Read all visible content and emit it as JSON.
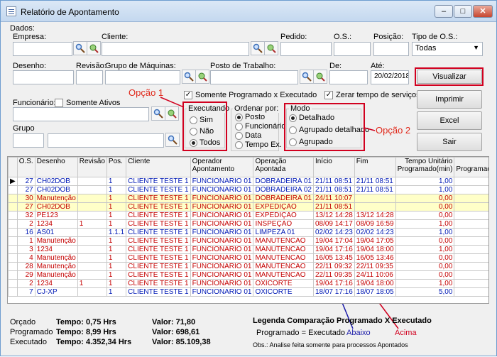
{
  "window": {
    "title": "Relatório de Apontamento"
  },
  "dados": {
    "group_title": "Dados:",
    "empresa_label": "Empresa:",
    "cliente_label": "Cliente:",
    "pedido_label": "Pedido:",
    "os_label": "O.S.:",
    "posicao_label": "Posição:",
    "tipo_os_label": "Tipo de O.S.:",
    "tipo_os_value": "Todas",
    "desenho_label": "Desenho:",
    "revisao_label": "Revisão:",
    "grupo_maquinas_label": "Grupo de Máquinas:",
    "posto_label": "Posto de Trabalho:",
    "de_label": "De:",
    "ate_label": "Até:",
    "ate_value": "20/02/2018",
    "funcionario_label": "Funcionário:",
    "somente_ativos_label": "Somente Ativos",
    "grupo_label": "Grupo",
    "somente_programado_label": "Somente Programado x Executado",
    "zerar_label": "Zerar tempo de serviços"
  },
  "executando": {
    "title": "Executando",
    "options": [
      "Sim",
      "Não",
      "Todos"
    ]
  },
  "ordenar": {
    "title": "Ordenar por:",
    "options": [
      "Posto",
      "Funcionário",
      "Data",
      "Tempo Ex."
    ]
  },
  "modo": {
    "title": "Modo",
    "options": [
      "Detalhado",
      "Agrupado detalhado",
      "Agrupado"
    ]
  },
  "annotations": {
    "opcao1": "Opção 1",
    "opcao2": "Opção 2",
    "abaixo": "Abaixo",
    "acima": "Acima"
  },
  "buttons": {
    "visualizar": "Visualizar",
    "imprimir": "Imprimir",
    "excel": "Excel",
    "sair": "Sair"
  },
  "table": {
    "headers": [
      "O.S.",
      "Desenho",
      "Revisão",
      "Pos.",
      "Cliente",
      "Operador Apontamento",
      "Operação Apontada",
      "Início",
      "Fim",
      "Tempo Unitário Programado(min)",
      "Tempo Programado(min)"
    ],
    "rows": [
      {
        "style": "blue",
        "cells": [
          "27",
          "CH02DOB",
          "",
          "1",
          "CLIENTE TESTE 1",
          "FUNCIONARIO 01",
          "DOBRADEIRA 01",
          "21/11 08:51",
          "21/11 08:51",
          "1,00",
          "40,00"
        ]
      },
      {
        "style": "blue",
        "cells": [
          "27",
          "CH02DOB",
          "",
          "1",
          "CLIENTE TESTE 1",
          "FUNCIONARIO 01",
          "DOBRADEIRA 02",
          "21/11 08:51",
          "21/11 08:51",
          "1,00",
          "40,00"
        ]
      },
      {
        "style": "red hi",
        "cells": [
          "30",
          "Manutenção",
          "",
          "1",
          "CLIENTE TESTE 1",
          "FUNCIONARIO 01",
          "DOBRADEIRA 01",
          "24/11 10:07",
          "",
          "0,00",
          "0,00"
        ]
      },
      {
        "style": "red hi",
        "cells": [
          "27",
          "CH02DOB",
          "",
          "1",
          "CLIENTE TESTE 1",
          "FUNCIONARIO 01",
          "EXPEDIÇÃO",
          "21/11 08:51",
          "",
          "0,00",
          "0,00"
        ]
      },
      {
        "style": "red",
        "cells": [
          "32",
          "PE123",
          "",
          "1",
          "CLIENTE TESTE 1",
          "FUNCIONARIO 01",
          "EXPEDIÇÃO",
          "13/12 14:28",
          "13/12 14:28",
          "0,00",
          "0,00"
        ]
      },
      {
        "style": "red",
        "cells": [
          "2",
          "1234",
          "1",
          "1",
          "CLIENTE TESTE 1",
          "FUNCIONARIO 01",
          "INSPEÇÃO",
          "08/09 14:17",
          "08/09 16:59",
          "1,00",
          "45,00"
        ]
      },
      {
        "style": "blue",
        "cells": [
          "16",
          "AS01",
          "",
          "1.1.1",
          "CLIENTE TESTE 1",
          "FUNCIONARIO 01",
          "LIMPEZA 01",
          "02/02 14:23",
          "02/02 14:23",
          "1,00",
          "0,00"
        ]
      },
      {
        "style": "red",
        "cells": [
          "1",
          "Manutenção",
          "",
          "1",
          "CLIENTE TESTE 1",
          "FUNCIONARIO 01",
          "MANUTENCAO",
          "19/04 17:04",
          "19/04 17:05",
          "0,00",
          "0,00"
        ]
      },
      {
        "style": "red",
        "cells": [
          "3",
          "1234",
          "",
          "1",
          "CLIENTE TESTE 1",
          "FUNCIONARIO 01",
          "MANUTENCAO",
          "19/04 17:16",
          "19/04 18:00",
          "1,00",
          "50,00"
        ]
      },
      {
        "style": "red",
        "cells": [
          "4",
          "Manutenção",
          "",
          "1",
          "CLIENTE TESTE 1",
          "FUNCIONARIO 01",
          "MANUTENCAO",
          "16/05 13:45",
          "16/05 13:46",
          "0,00",
          "0,00"
        ]
      },
      {
        "style": "red",
        "cells": [
          "28",
          "Manutenção",
          "",
          "1",
          "CLIENTE TESTE 1",
          "FUNCIONARIO 01",
          "MANUTENCAO",
          "22/11 09:32",
          "22/11 09:35",
          "0,00",
          "0,00"
        ]
      },
      {
        "style": "red",
        "cells": [
          "29",
          "Manutenção",
          "",
          "1",
          "CLIENTE TESTE 1",
          "FUNCIONARIO 01",
          "MANUTENCAO",
          "22/11 09:35",
          "24/11 10:06",
          "0,00",
          "0,00"
        ]
      },
      {
        "style": "red",
        "cells": [
          "2",
          "1234",
          "1",
          "1",
          "CLIENTE TESTE 1",
          "FUNCIONARIO 01",
          "OXICORTE",
          "19/04 17:16",
          "19/04 18:00",
          "1,00",
          "60,00"
        ]
      },
      {
        "style": "blue",
        "cells": [
          "7",
          "CJ-XP",
          "",
          "1",
          "CLIENTE TESTE 1",
          "FUNCIONARIO 01",
          "OXICORTE",
          "18/07 17:16",
          "18/07 18:05",
          "5,00",
          "201,00"
        ]
      }
    ]
  },
  "footer": {
    "rows": [
      {
        "label": "Orçado",
        "tempo": "Tempo: 0,75 Hrs",
        "valor": "Valor: 71,80"
      },
      {
        "label": "Programado",
        "tempo": "Tempo: 8,99 Hrs",
        "valor": "Valor: 698,61"
      },
      {
        "label": "Executado",
        "tempo": "Tempo: 4.352,34 Hrs",
        "valor": "Valor: 85.109,38"
      }
    ],
    "legend_title": "Legenda Comparação Programado X Executado",
    "legend_equal": "Programado = Executado",
    "legend_obs": "Obs.: Analise feita somente para processos Apontados"
  },
  "colors": {
    "blue_text": "#0019b5",
    "red_text": "#c40000",
    "highlight": "#ffffc8",
    "annotation": "#d1001f"
  }
}
